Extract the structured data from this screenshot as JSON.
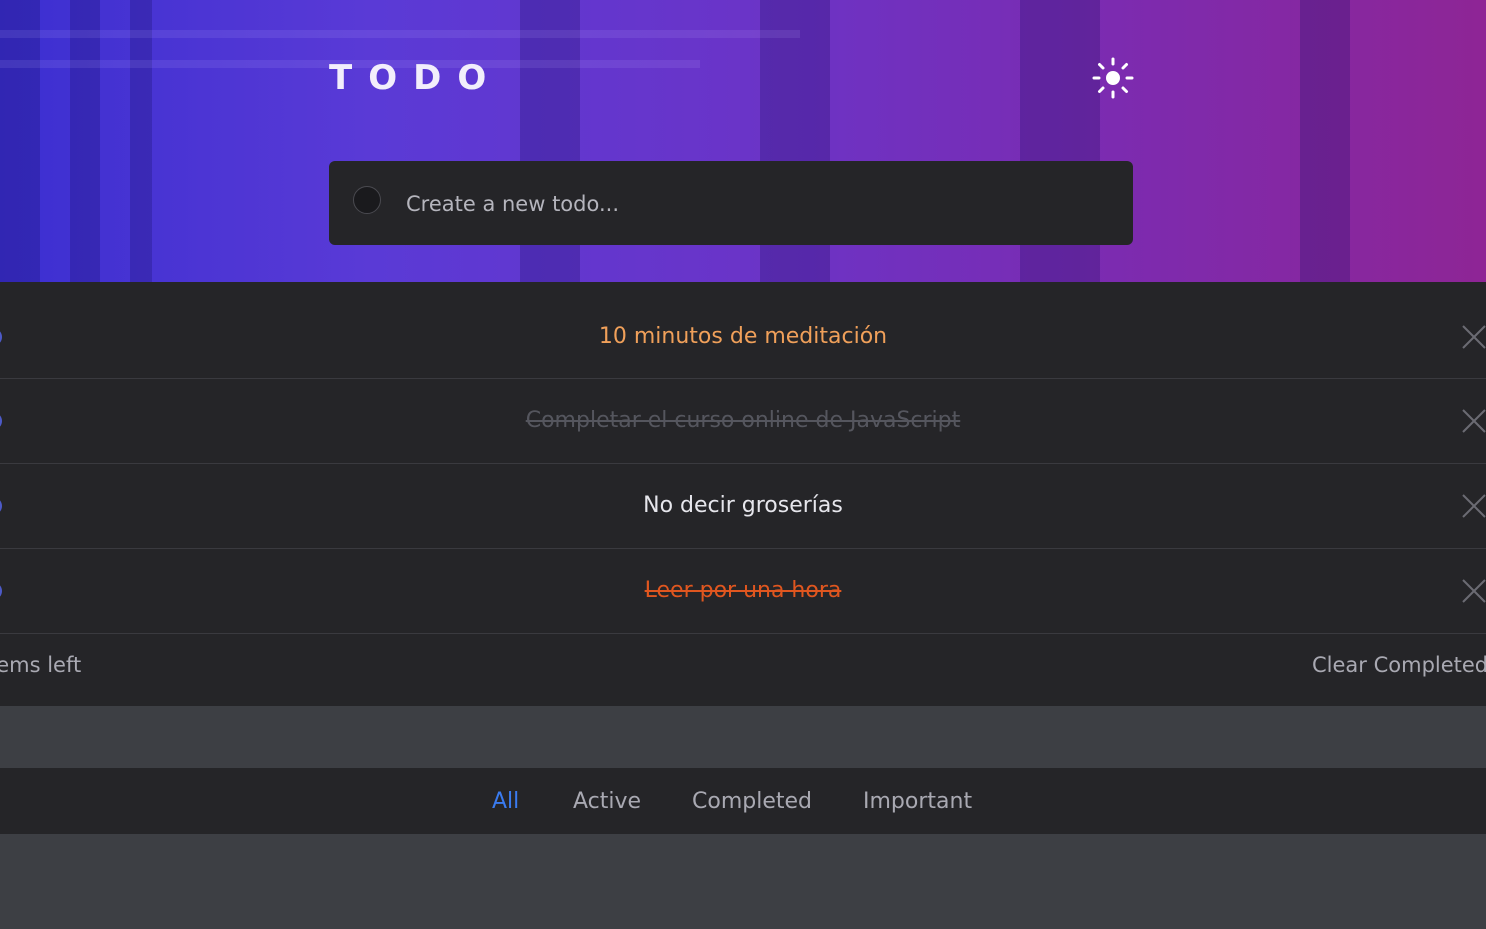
{
  "header": {
    "title": "TODO",
    "theme_toggle_icon": "sun-icon"
  },
  "new_todo": {
    "placeholder": "Create a new todo..."
  },
  "todos": [
    {
      "text": "10 minutos de meditación",
      "completed": false,
      "color": "#f0a05a"
    },
    {
      "text": "Completar el curso online de JavaScript",
      "completed": true,
      "color": "#55565e"
    },
    {
      "text": "No decir groserías",
      "completed": false,
      "color": "#e6e6ec"
    },
    {
      "text": "Leer por una hora",
      "completed": true,
      "color": "#e0561f"
    }
  ],
  "footer": {
    "items_left": "tems left",
    "clear_completed": "Clear Completed"
  },
  "filters": {
    "all": "All",
    "active": "Active",
    "completed": "Completed",
    "important": "Important",
    "selected": "All"
  },
  "colors": {
    "accent": "#3a7bef",
    "card_bg": "#252528",
    "page_bg": "#3d3f44"
  }
}
